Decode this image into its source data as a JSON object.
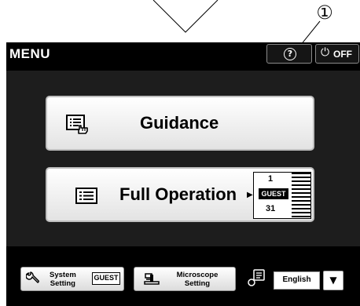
{
  "callout": {
    "number": "①"
  },
  "titlebar": {
    "title": "MENU",
    "help_symbol": "?",
    "power_symbol": "⏻",
    "off_label": "OFF"
  },
  "main": {
    "guidance_label": "Guidance",
    "full_operation_label": "Full Operation",
    "mode_indicator": {
      "top": "1",
      "badge": "GUEST",
      "bottom": "31"
    }
  },
  "bottom": {
    "system_line1": "System",
    "system_line2": "Setting",
    "system_badge": "GUEST",
    "microscope_line1": "Microscope",
    "microscope_line2": "Setting",
    "language_value": "English",
    "dropdown_symbol": "▼"
  },
  "icons": {
    "help": "help-icon",
    "power": "power-icon",
    "guidance": "guidance-list-hand-icon",
    "full_operation": "list-icon",
    "system_setting": "wrench-icon",
    "microscope_setting": "microscope-icon",
    "language": "language-icon"
  },
  "colors": {
    "screen_bg": "#000000",
    "content_bg": "#1d1d1d",
    "button_face": "#f2f2f2"
  }
}
